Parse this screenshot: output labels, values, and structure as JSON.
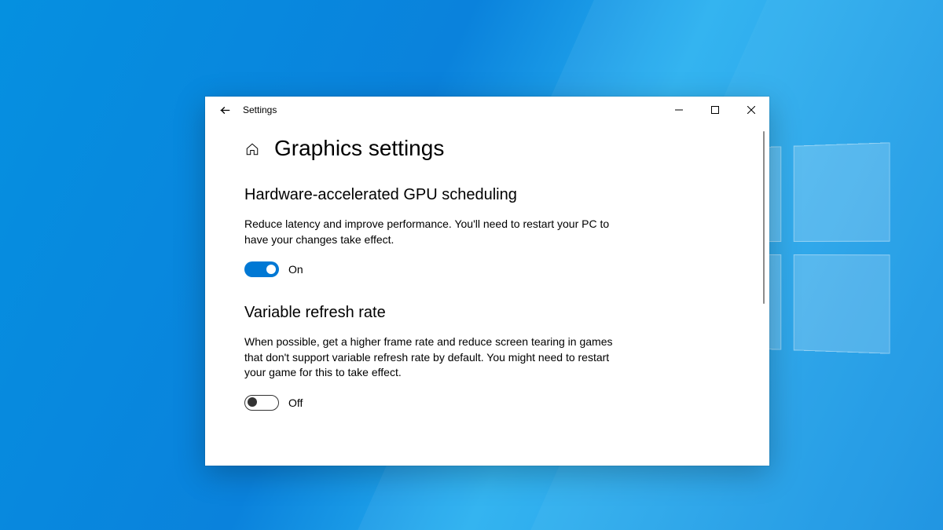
{
  "titlebar": {
    "app_name": "Settings"
  },
  "page": {
    "title": "Graphics settings"
  },
  "sections": {
    "gpu": {
      "heading": "Hardware-accelerated GPU scheduling",
      "description": "Reduce latency and improve performance. You'll need to restart your PC to have your changes take effect.",
      "toggle_on": true,
      "toggle_label": "On"
    },
    "vrr": {
      "heading": "Variable refresh rate",
      "description": "When possible, get a higher frame rate and reduce screen tearing in games that don't support variable refresh rate by default. You might need to restart your game for this to take effect.",
      "toggle_on": false,
      "toggle_label": "Off"
    }
  },
  "colors": {
    "accent": "#0078d4"
  }
}
